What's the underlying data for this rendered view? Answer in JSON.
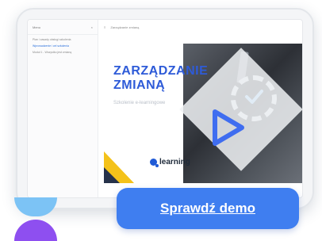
{
  "demo": {
    "sidebar": {
      "title": "Menu",
      "items": [
        {
          "label": "Plan i zasady obsługi szkolenia"
        },
        {
          "label": "Wprowadzenie i cel szkolenia"
        },
        {
          "label": "Moduł 1 - Wszystko jest zmianą"
        }
      ]
    },
    "topbar": {
      "breadcrumb": "Zarządzanie zmianą"
    },
    "slide": {
      "title_line1": "ZARZĄDZANIE",
      "title_line2": "ZMIANĄ",
      "subtitle": "Szkolenie e-learningowe",
      "logo_text": "learning"
    }
  },
  "cta": {
    "label": "Sprawdź demo"
  },
  "colors": {
    "accent_blue": "#3f7ef0",
    "title_blue": "#2e5bd8",
    "yellow": "#f4c21a",
    "deco_light_blue": "#7cc3f5",
    "deco_purple": "#8e4ff0"
  },
  "icons": {
    "play": "play-icon",
    "gear": "gear-icon",
    "check": "check-icon"
  }
}
